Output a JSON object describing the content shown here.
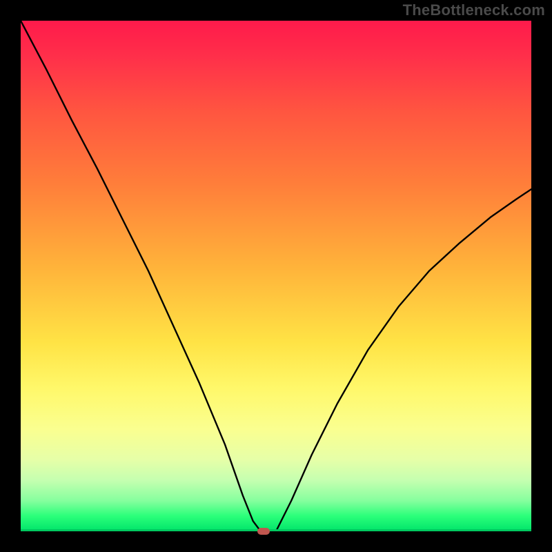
{
  "watermark": "TheBottleneck.com",
  "marker": {
    "x_fraction": 0.475
  },
  "chart_data": {
    "type": "line",
    "title": "",
    "xlabel": "",
    "ylabel": "",
    "xlim": [
      0,
      1
    ],
    "ylim": [
      0,
      1
    ],
    "note": "Curve shows bottleneck deviation; minimum (0) at x≈0.475 where marker sits. Left branch rises steeply to 1 at x=0, right branch rises to ≈0.67 at x=1. Background gradient encodes severity (red=high, green=low).",
    "series": [
      {
        "name": "left-branch",
        "x": [
          0.0,
          0.05,
          0.1,
          0.15,
          0.2,
          0.25,
          0.3,
          0.35,
          0.4,
          0.435,
          0.455,
          0.47
        ],
        "y": [
          1.0,
          0.905,
          0.805,
          0.71,
          0.61,
          0.51,
          0.4,
          0.29,
          0.17,
          0.07,
          0.02,
          0.0
        ]
      },
      {
        "name": "flat-zero",
        "x": [
          0.47,
          0.5
        ],
        "y": [
          0.0,
          0.0
        ]
      },
      {
        "name": "right-branch",
        "x": [
          0.5,
          0.53,
          0.57,
          0.62,
          0.68,
          0.74,
          0.8,
          0.86,
          0.92,
          0.97,
          1.0
        ],
        "y": [
          0.0,
          0.06,
          0.15,
          0.25,
          0.355,
          0.44,
          0.51,
          0.565,
          0.615,
          0.65,
          0.67
        ]
      }
    ],
    "marker_point": {
      "x": 0.475,
      "y": 0.0
    },
    "gradient_stops": [
      {
        "pos": 0.0,
        "color": "#ff1a4b"
      },
      {
        "pos": 0.32,
        "color": "#ff7e3a"
      },
      {
        "pos": 0.63,
        "color": "#ffe345"
      },
      {
        "pos": 0.86,
        "color": "#e6ffa8"
      },
      {
        "pos": 1.0,
        "color": "#00e46a"
      }
    ]
  }
}
